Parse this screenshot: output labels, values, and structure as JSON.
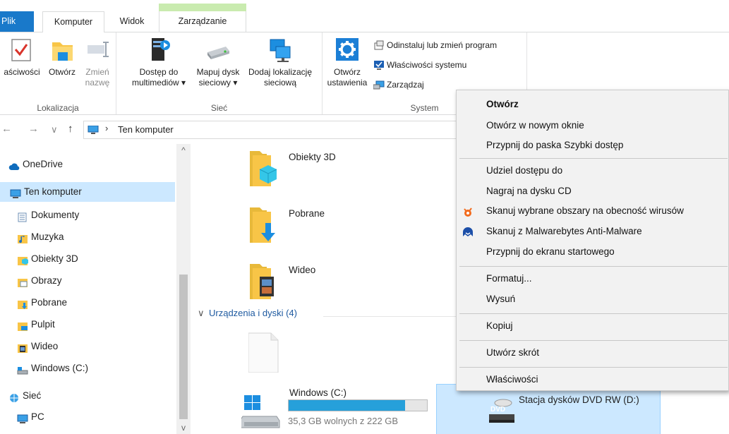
{
  "tabs": {
    "file": "Plik",
    "computer": "Komputer",
    "view": "Widok",
    "manage": "Zarządzanie"
  },
  "ribbon": {
    "location": {
      "label": "Lokalizacja",
      "properties": "aściwości",
      "open": "Otwórz",
      "rename_line1": "Zmień",
      "rename_line2": "nazwę"
    },
    "network": {
      "label": "Sieć",
      "media_line1": "Dostęp do",
      "media_line2": "multimediów ▾",
      "map_line1": "Mapuj dysk",
      "map_line2": "sieciowy ▾",
      "add_line1": "Dodaj lokalizację",
      "add_line2": "sieciową"
    },
    "system": {
      "label": "System",
      "settings_line1": "Otwórz",
      "settings_line2": "ustawienia",
      "uninstall": "Odinstaluj lub zmień program",
      "sys_props": "Właściwości systemu",
      "manage": "Zarządzaj"
    }
  },
  "address": {
    "back": "←",
    "forward": "→",
    "recent": "∨",
    "up": "↑",
    "separator": "›",
    "path": "Ten komputer"
  },
  "sidebar": {
    "items": [
      {
        "label": "OneDrive",
        "icon": "cloud-icon"
      },
      {
        "label": "Ten komputer",
        "icon": "computer-icon"
      },
      {
        "label": "Dokumenty",
        "icon": "documents-icon"
      },
      {
        "label": "Muzyka",
        "icon": "music-icon"
      },
      {
        "label": "Obiekty 3D",
        "icon": "3d-objects-icon"
      },
      {
        "label": "Obrazy",
        "icon": "pictures-icon"
      },
      {
        "label": "Pobrane",
        "icon": "downloads-icon"
      },
      {
        "label": "Pulpit",
        "icon": "desktop-icon"
      },
      {
        "label": "Wideo",
        "icon": "video-icon"
      },
      {
        "label": "Windows (C:)",
        "icon": "drive-icon"
      },
      {
        "label": "Sieć",
        "icon": "network-icon"
      },
      {
        "label": "PC",
        "icon": "computer-icon"
      }
    ]
  },
  "main": {
    "folders": [
      "Obiekty 3D",
      "Pobrane",
      "Wideo"
    ],
    "group_header": "Urządzenia i dyski (4)",
    "drive_c": {
      "name": "Windows (C:)",
      "free": "35,3 GB wolnych z 222 GB",
      "used_fraction": 0.84
    },
    "dvd": {
      "name": "Stacja dysków DVD RW (D:)",
      "badge": "DVD"
    }
  },
  "context_menu": {
    "items": [
      {
        "label": "Otwórz",
        "bold": true
      },
      {
        "label": "Otwórz w nowym oknie"
      },
      {
        "label": "Przypnij do paska Szybki dostęp"
      },
      {
        "label": "Udziel dostępu do"
      },
      {
        "label": "Nagraj na dysku CD"
      },
      {
        "label": "Skanuj wybrane obszary na obecność wirusów",
        "icon": "avast-icon"
      },
      {
        "label": "Skanuj z Malwarebytes Anti-Malware",
        "icon": "malwarebytes-icon"
      },
      {
        "label": "Przypnij do ekranu startowego"
      },
      {
        "label": "Formatuj..."
      },
      {
        "label": "Wysuń"
      },
      {
        "label": "Kopiuj"
      },
      {
        "label": "Utwórz skrót"
      },
      {
        "label": "Właściwości"
      }
    ]
  },
  "colors": {
    "accent": "#1979ca",
    "selection": "#cce8ff",
    "manage_band": "#c9ebaf",
    "progress": "#26a0da"
  }
}
